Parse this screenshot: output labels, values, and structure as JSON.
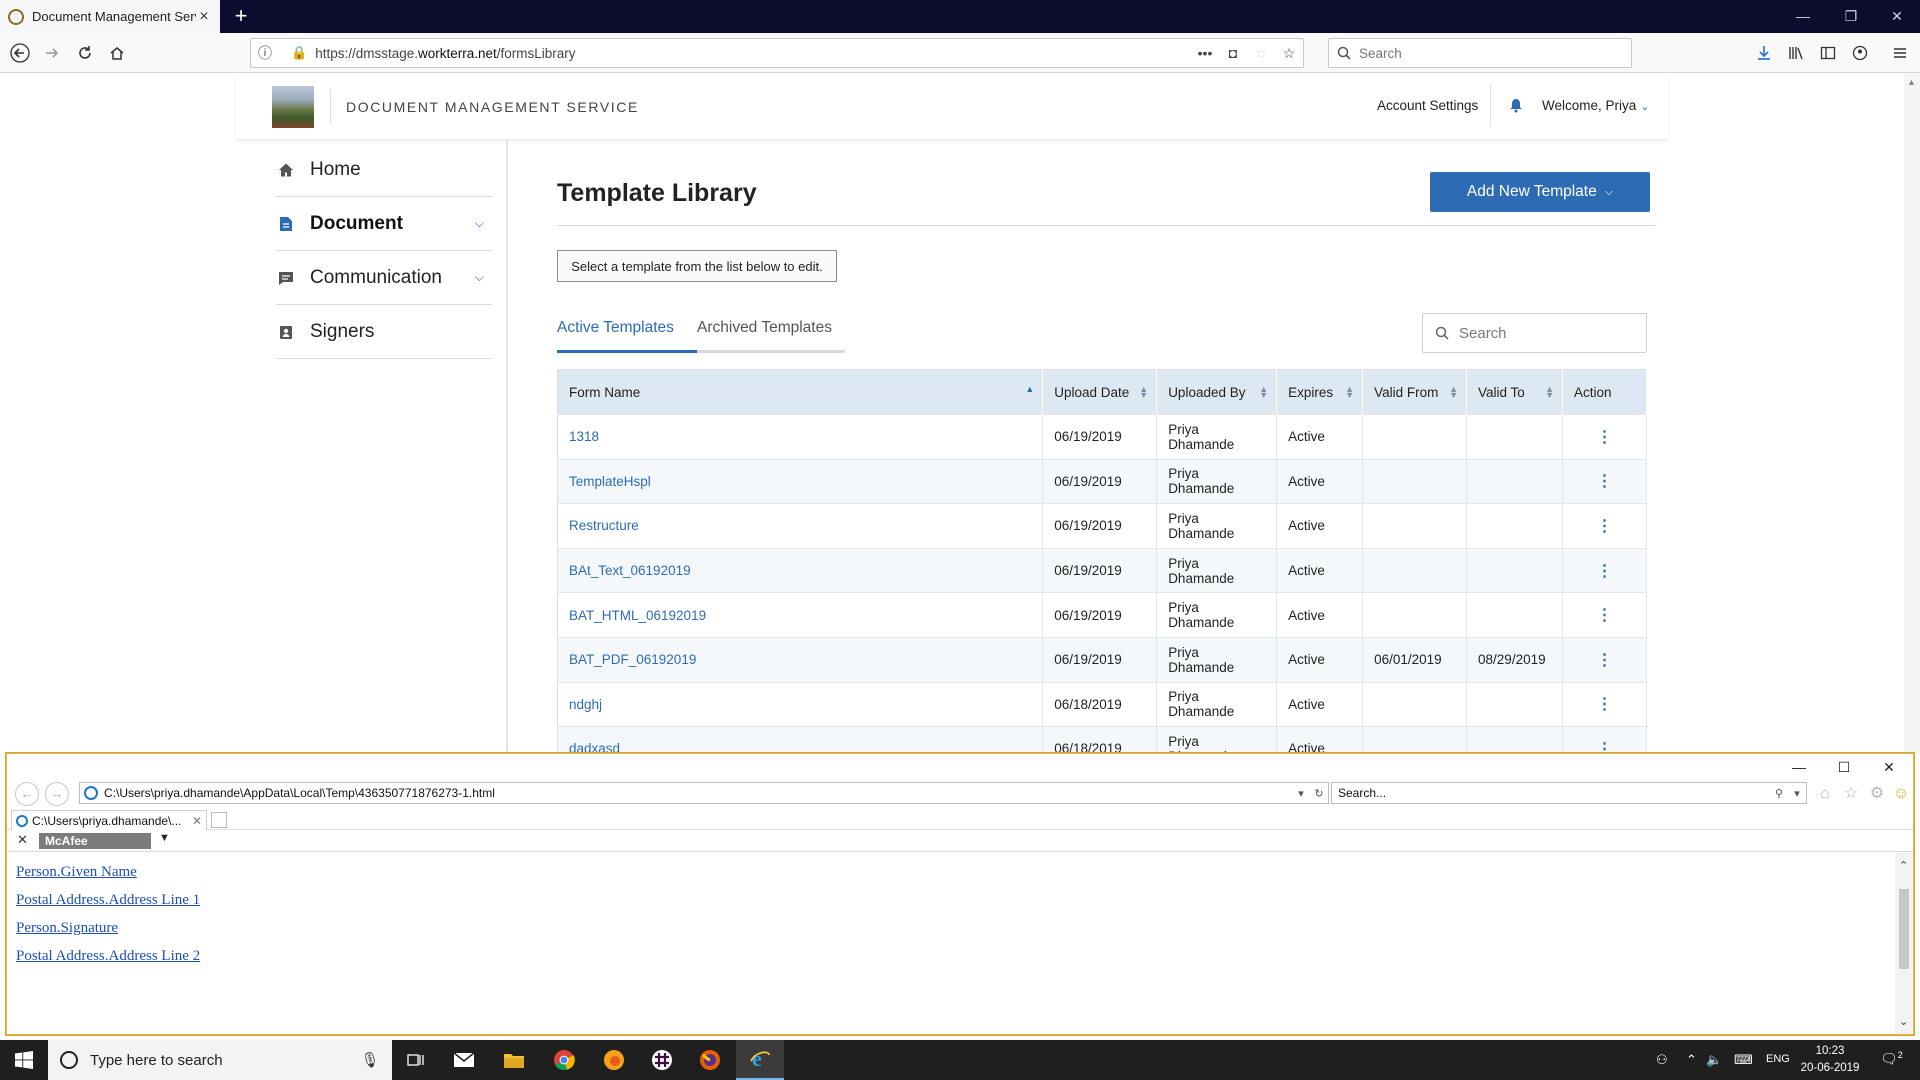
{
  "browser": {
    "tab_title": "Document Management Servic",
    "url_prefix": "https://dmsstage.",
    "url_host": "workterra.net",
    "url_path": "/formsLibrary",
    "search_placeholder": "Search"
  },
  "app": {
    "title": "DOCUMENT MANAGEMENT SERVICE",
    "account_settings": "Account Settings",
    "welcome": "Welcome, Priya"
  },
  "sidebar": {
    "items": [
      {
        "label": "Home",
        "icon": "home-icon"
      },
      {
        "label": "Document",
        "icon": "document-icon"
      },
      {
        "label": "Communication",
        "icon": "chat-icon"
      },
      {
        "label": "Signers",
        "icon": "signer-icon"
      }
    ]
  },
  "main": {
    "title": "Template Library",
    "add_button": "Add New Template",
    "hint": "Select a template from the list below to edit.",
    "tabs": [
      "Active Templates",
      "Archived Templates"
    ],
    "search_placeholder": "Search",
    "columns": [
      "Form Name",
      "Upload Date",
      "Uploaded By",
      "Expires",
      "Valid From",
      "Valid To",
      "Action"
    ],
    "rows": [
      {
        "name": "1318",
        "date": "06/19/2019",
        "by": "Priya Dhamande",
        "expires": "Active",
        "from": "",
        "to": ""
      },
      {
        "name": "TemplateHspl",
        "date": "06/19/2019",
        "by": "Priya Dhamande",
        "expires": "Active",
        "from": "",
        "to": ""
      },
      {
        "name": "Restructure",
        "date": "06/19/2019",
        "by": "Priya Dhamande",
        "expires": "Active",
        "from": "",
        "to": ""
      },
      {
        "name": "BAt_Text_06192019",
        "date": "06/19/2019",
        "by": "Priya Dhamande",
        "expires": "Active",
        "from": "",
        "to": ""
      },
      {
        "name": "BAT_HTML_06192019",
        "date": "06/19/2019",
        "by": "Priya Dhamande",
        "expires": "Active",
        "from": "",
        "to": ""
      },
      {
        "name": "BAT_PDF_06192019",
        "date": "06/19/2019",
        "by": "Priya Dhamande",
        "expires": "Active",
        "from": "06/01/2019",
        "to": "08/29/2019"
      },
      {
        "name": "ndghj",
        "date": "06/18/2019",
        "by": "Priya Dhamande",
        "expires": "Active",
        "from": "",
        "to": ""
      },
      {
        "name": "dadxasd",
        "date": "06/18/2019",
        "by": "Priya Dhamande",
        "expires": "Active",
        "from": "",
        "to": ""
      }
    ]
  },
  "ie": {
    "address": "C:\\Users\\priya.dhamande\\AppData\\Local\\Temp\\436350771876273-1.html",
    "search_placeholder": "Search...",
    "tab_title": "C:\\Users\\priya.dhamande\\...",
    "mcafee": "McAfee",
    "links": [
      "Person.Given Name",
      "Postal Address.Address Line 1",
      "Person.Signature",
      "Postal Address.Address Line 2"
    ]
  },
  "taskbar": {
    "search_placeholder": "Type here to search",
    "lang": "ENG",
    "time": "10:23",
    "date": "20-06-2019",
    "notifications": "2"
  }
}
